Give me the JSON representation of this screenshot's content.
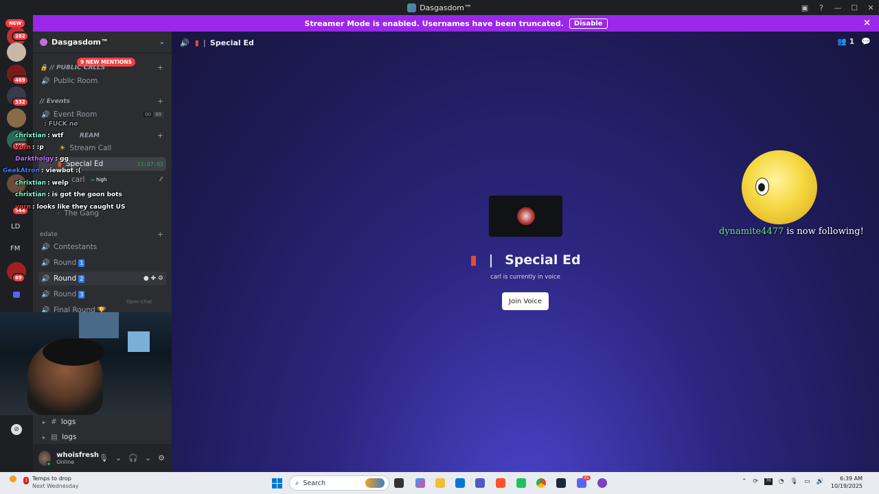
{
  "window": {
    "title": "Dasgasdom™"
  },
  "banner": {
    "text": "Streamer Mode is enabled. Usernames have been truncated.",
    "disable_label": "Disable",
    "close_icon": "×"
  },
  "rail": {
    "new_label": "NEW",
    "badges": [
      "282",
      "469",
      "332",
      "106",
      "544",
      "69"
    ],
    "text_servers": [
      "LD",
      "FM"
    ]
  },
  "sidebar": {
    "server_name": "Dasgasdom™",
    "mentions": "9 NEW MENTIONS",
    "categories": {
      "public": "// PUBLIC CALLS",
      "events": "// Events",
      "stream": "REAM",
      "edate": "edate"
    },
    "channels": {
      "public_room": "Public Room",
      "event_room": "Event Room",
      "event_room_counts": [
        "00",
        "99"
      ],
      "stream_call": "Stream Call",
      "special_ed": "Special Ed",
      "special_ed_timer": "13:07:03",
      "carl": "carl",
      "carl_quality": "high",
      "the_gang": "The Gang",
      "contestants": "Contestants",
      "round_label": "Round",
      "round_nums": [
        "1",
        "2",
        "3"
      ],
      "final_round": "Final Round",
      "open_chat": "Open Chat"
    },
    "logs": [
      "logs",
      "logs"
    ]
  },
  "stream_chat": {
    "messages": [
      {
        "user": "",
        "text": ": FUCK no",
        "color": "#949ba4"
      },
      {
        "user": "chrixtian",
        "text": ": wtf",
        "color": "#7fffd4"
      },
      {
        "user": "vorn",
        "text": ": :p",
        "color": "#ff4040"
      },
      {
        "user": "Darktholgy",
        "text": ": gg",
        "color": "#c070ff"
      },
      {
        "user": "GeekAtron",
        "text": ": viewbot :(",
        "color": "#4080ff"
      },
      {
        "user": "chrixtian",
        "text": ": welp",
        "color": "#7fffd4"
      },
      {
        "user": "chrixtian",
        "text": ": is got the goon bots",
        "color": "#7fffd4"
      },
      {
        "user": "vorn",
        "text": ": looks like they caught US",
        "color": "#ff4040"
      }
    ]
  },
  "user_panel": {
    "name": "whoisfresh",
    "status": "Online"
  },
  "main": {
    "channel_name": "Special Ed",
    "member_count": "1",
    "title": "Special Ed",
    "subtitle": "carl is currently in voice",
    "join_label": "Join Voice"
  },
  "alert": {
    "username": "dynamite4477",
    "text": "is now following!"
  },
  "taskbar": {
    "weather_title": "Temps to drop",
    "weather_sub": "Next Wednesday",
    "weather_badge": "3",
    "search_placeholder": "Search",
    "time": "6:39 AM",
    "date": "10/19/2025",
    "discord_badge": "35",
    "tray_temp": "70"
  },
  "colors": {
    "accent": "#9a28e8",
    "active_channel": "#404249",
    "follow_user": "#6ee08a"
  }
}
